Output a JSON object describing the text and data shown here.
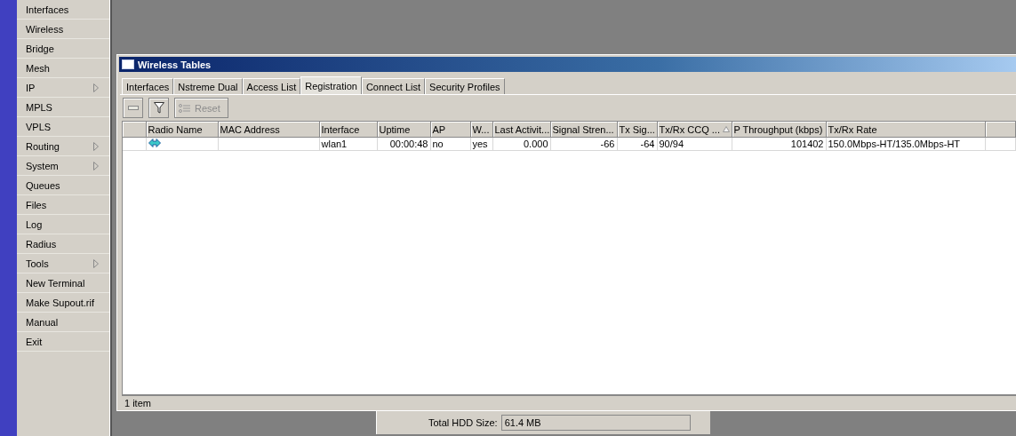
{
  "sidebar": {
    "items": [
      {
        "label": "Interfaces",
        "submenu": false
      },
      {
        "label": "Wireless",
        "submenu": false
      },
      {
        "label": "Bridge",
        "submenu": false
      },
      {
        "label": "Mesh",
        "submenu": false
      },
      {
        "label": "IP",
        "submenu": true
      },
      {
        "label": "MPLS",
        "submenu": false
      },
      {
        "label": "VPLS",
        "submenu": false
      },
      {
        "label": "Routing",
        "submenu": true
      },
      {
        "label": "System",
        "submenu": true
      },
      {
        "label": "Queues",
        "submenu": false
      },
      {
        "label": "Files",
        "submenu": false
      },
      {
        "label": "Log",
        "submenu": false
      },
      {
        "label": "Radius",
        "submenu": false
      },
      {
        "label": "Tools",
        "submenu": true
      },
      {
        "label": "New Terminal",
        "submenu": false
      },
      {
        "label": "Make Supout.rif",
        "submenu": false
      },
      {
        "label": "Manual",
        "submenu": false
      },
      {
        "label": "Exit",
        "submenu": false
      }
    ]
  },
  "window": {
    "title": "Wireless Tables",
    "tabs": [
      {
        "label": "Interfaces",
        "selected": false
      },
      {
        "label": "Nstreme Dual",
        "selected": false
      },
      {
        "label": "Access List",
        "selected": false
      },
      {
        "label": "Registration",
        "selected": true
      },
      {
        "label": "Connect List",
        "selected": false
      },
      {
        "label": "Security Profiles",
        "selected": false
      }
    ],
    "toolbar": [
      {
        "kind": "remove"
      },
      {
        "kind": "filter"
      },
      {
        "kind": "reset",
        "label": "Reset",
        "disabled": true
      }
    ],
    "table": {
      "columns": [
        {
          "label": "Radio Name",
          "kind": "text",
          "sorted": false
        },
        {
          "label": "MAC Address",
          "kind": "text",
          "sorted": false
        },
        {
          "label": "Interface",
          "kind": "text",
          "sorted": false
        },
        {
          "label": "Uptime",
          "kind": "number",
          "sorted": false
        },
        {
          "label": "AP",
          "kind": "text",
          "sorted": false
        },
        {
          "label": "W...",
          "kind": "text",
          "sorted": false
        },
        {
          "label": "Last Activit...",
          "kind": "number",
          "sorted": false
        },
        {
          "label": "Signal Stren...",
          "kind": "number",
          "sorted": false
        },
        {
          "label": "Tx Sig...",
          "kind": "number",
          "sorted": false
        },
        {
          "label": "Tx/Rx CCQ ...",
          "kind": "text",
          "sorted": true
        },
        {
          "label": "P Throughput (kbps)",
          "kind": "number",
          "sorted": false
        },
        {
          "label": "Tx/Rx Rate",
          "kind": "text",
          "sorted": false
        }
      ],
      "rows": [
        {
          "kind": "station",
          "cells": [
            "",
            "",
            "wlan1",
            "00:00:48",
            "no",
            "yes",
            "0.000",
            "-66",
            "-64",
            "90/94",
            "101402",
            "150.0Mbps-HT/135.0Mbps-HT"
          ]
        }
      ]
    },
    "status_bar": "1 item"
  },
  "background_panel": {
    "label": "Total HDD Size:",
    "value": "61.4 MB"
  }
}
